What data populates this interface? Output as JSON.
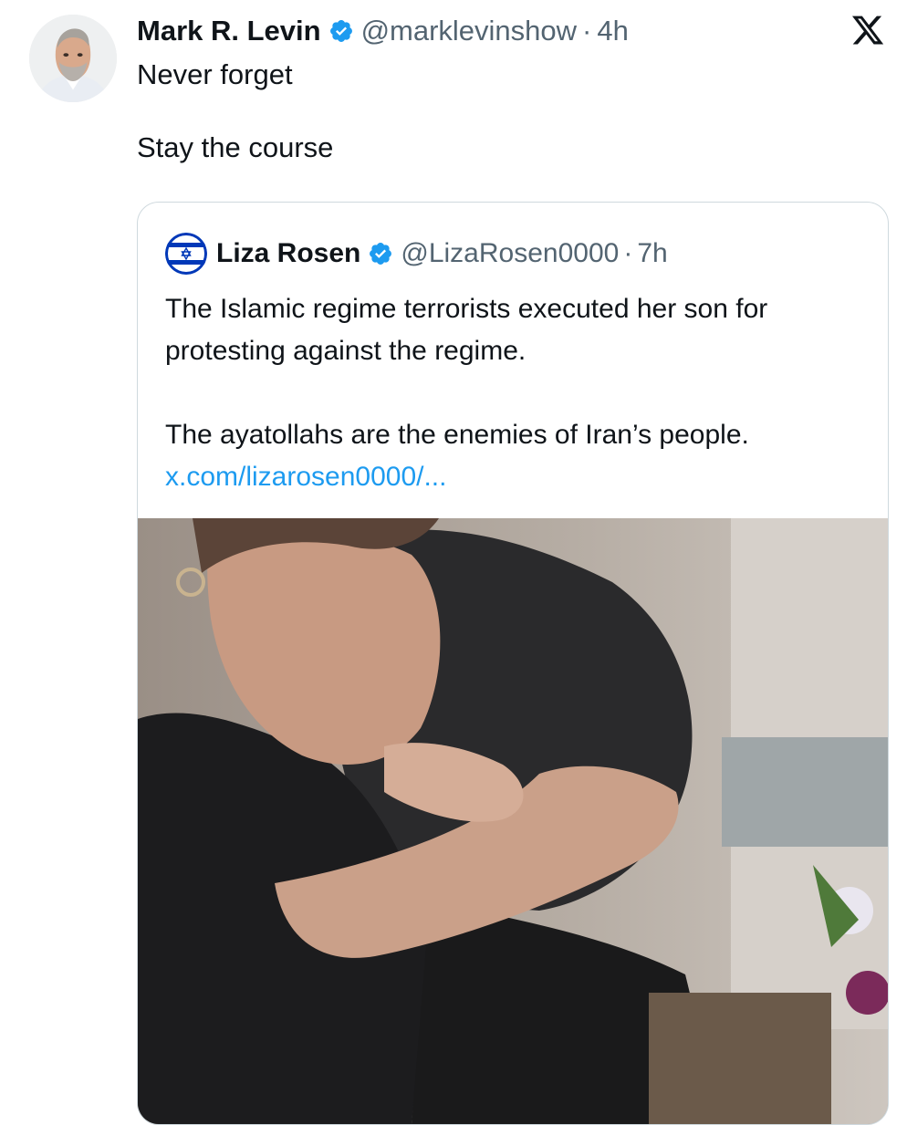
{
  "tweet": {
    "author": {
      "display_name": "Mark R. Levin",
      "handle": "@marklevinshow",
      "separator": "·",
      "time": "4h"
    },
    "text": "Never forget\n\nStay the course",
    "quote": {
      "author": {
        "display_name": "Liza Rosen",
        "handle": "@LizaRosen0000",
        "separator": "·",
        "time": "7h"
      },
      "paragraph1": "The Islamic regime terrorists executed her son for protesting against the regime.",
      "paragraph2_text": "The ayatollahs are the enemies of Iran’s people.",
      "link": "x.com/lizarosen0000/..."
    }
  },
  "icons": {
    "verified": "verified-badge-icon",
    "platform_logo": "x-logo-icon"
  },
  "colors": {
    "text_primary": "#0f1419",
    "text_secondary": "#536471",
    "link": "#1d9bf0",
    "verified": "#1d9bf0",
    "border": "#cfd9de"
  }
}
